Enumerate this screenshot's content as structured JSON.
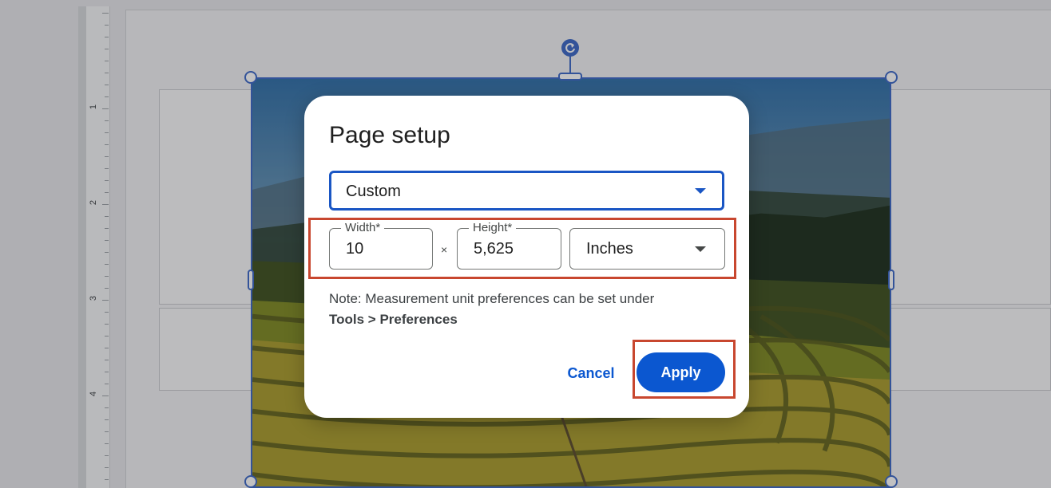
{
  "ruler": {
    "numbers": [
      "1",
      "2",
      "3",
      "4"
    ]
  },
  "dialog": {
    "title": "Page setup",
    "preset": {
      "value": "Custom"
    },
    "width": {
      "label": "Width*",
      "value": "10"
    },
    "separator": "×",
    "height": {
      "label": "Height*",
      "value": "5,625"
    },
    "unit": {
      "value": "Inches"
    },
    "note_text": "Note: Measurement unit preferences can be set under",
    "note_path": "Tools > Preferences",
    "cancel_label": "Cancel",
    "apply_label": "Apply"
  },
  "icons": {
    "rotate": "rotate-icon",
    "preset_dropdown": "chevron-down-icon",
    "unit_dropdown": "chevron-down-icon"
  },
  "colors": {
    "accent": "#0b57d0",
    "selection": "#3b67c7",
    "highlight": "#c8472f"
  }
}
